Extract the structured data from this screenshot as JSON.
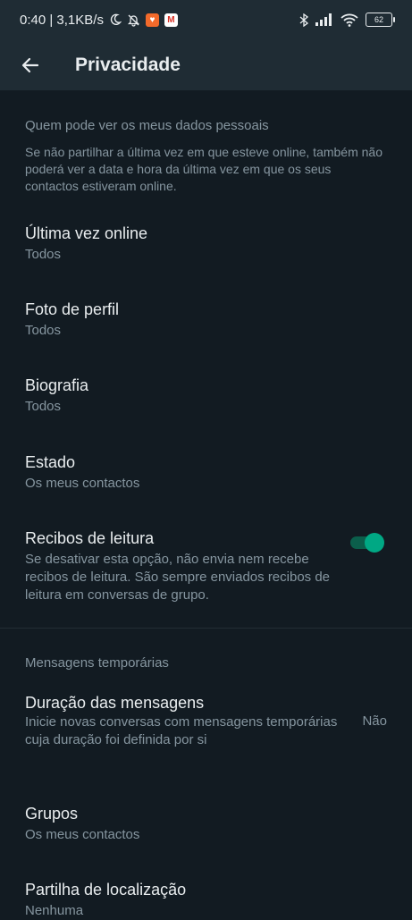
{
  "status_bar": {
    "time_speed": "0:40 | 3,1KB/s",
    "battery": "62",
    "icons": [
      "moon-icon",
      "bell-off-icon",
      "brave-app-icon",
      "gmail-app-icon",
      "bluetooth-icon",
      "signal-icon",
      "wifi-icon",
      "battery-icon"
    ]
  },
  "app_bar": {
    "title": "Privacidade",
    "back_icon": "arrow-left-icon"
  },
  "personal_section": {
    "title": "Quem pode ver os meus dados pessoais",
    "description": "Se não partilhar a última vez em que esteve online, também não poderá ver a data e hora da última vez em que os seus contactos estiveram online."
  },
  "items": [
    {
      "title": "Última vez online",
      "value": "Todos"
    },
    {
      "title": "Foto de perfil",
      "value": "Todos"
    },
    {
      "title": "Biografia",
      "value": "Todos"
    },
    {
      "title": "Estado",
      "value": "Os meus contactos"
    }
  ],
  "read_receipts": {
    "title": "Recibos de leitura",
    "description": "Se desativar esta opção, não envia nem recebe recibos de leitura. São sempre enviados recibos de leitura em conversas de grupo.",
    "enabled": true
  },
  "temp_section": {
    "title": "Mensagens temporárias"
  },
  "message_duration": {
    "title": "Duração das mensagens",
    "description": "Inicie novas conversas com mensagens temporárias cuja duração foi definida por si",
    "value": "Não"
  },
  "groups": {
    "title": "Grupos",
    "value": "Os meus contactos"
  },
  "location": {
    "title": "Partilha de localização",
    "value": "Nenhuma"
  },
  "colors": {
    "background": "#121b22",
    "app_bar": "#1f2c34",
    "accent": "#00a884",
    "secondary_text": "#8696a0"
  }
}
